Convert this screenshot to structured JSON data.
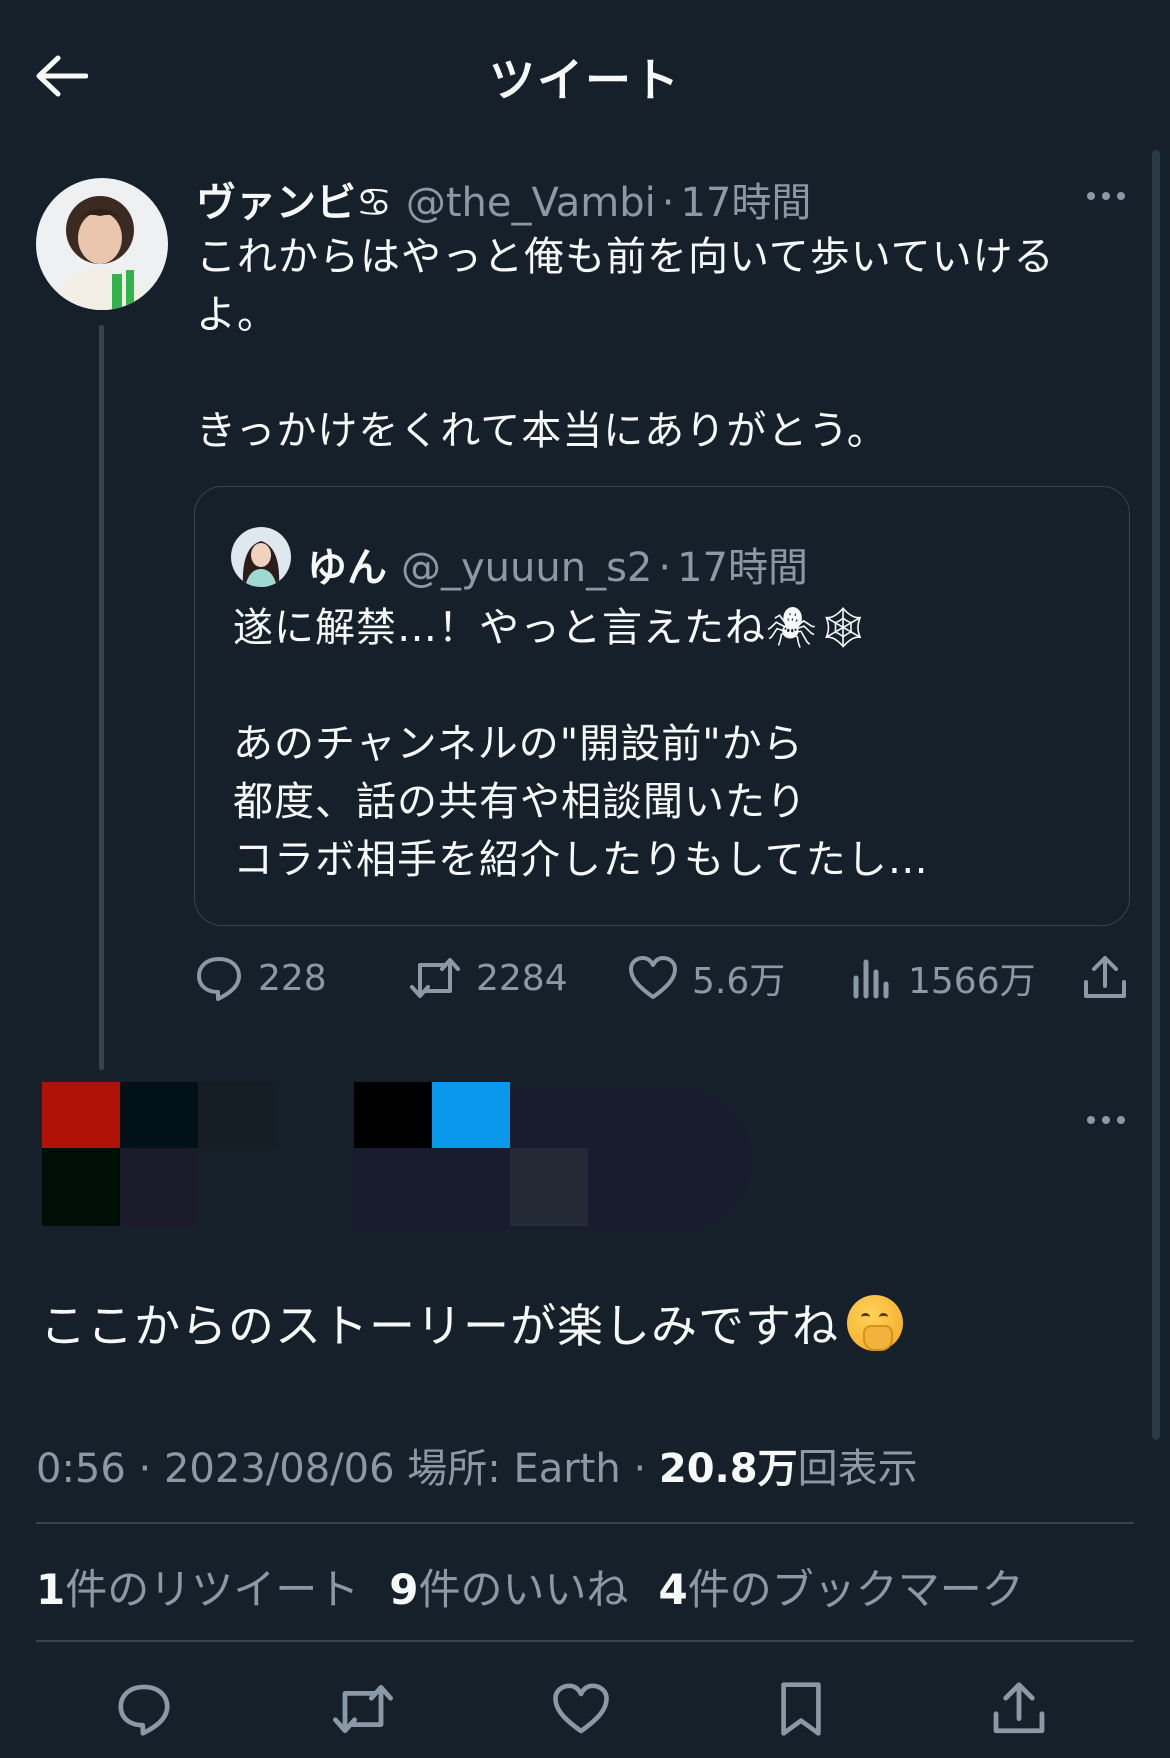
{
  "header": {
    "title": "ツイート"
  },
  "tweet": {
    "name": "ヴァンビ♋",
    "handle": "@the_Vambi",
    "sep": "·",
    "time": "17時間",
    "text": "これからはやっと俺も前を向いて歩いていける\nよ。\n\nきっかけをくれて本当にありがとう。",
    "quote": {
      "name": "ゆん",
      "handle": "@_yuuun_s2",
      "sep": "·",
      "time": "17時間",
      "text": "遂に解禁…！やっと言えたね🕷🕸\n\nあのチャンネルの\"開設前\"から\n都度、話の共有や相談聞いたり\nコラボ相手を紹介したりもしてたし…"
    },
    "actions": {
      "reply_count": "228",
      "retweet_count": "2284",
      "like_count": "5.6万",
      "view_count": "1566万"
    }
  },
  "reply": {
    "text": "ここからのストーリーが楽しみですね",
    "emoji_icon": "hand-over-mouth-emoji"
  },
  "meta": {
    "time": "0:56",
    "sep1": "·",
    "date": "2023/08/06",
    "location": "場所: Earth",
    "sep2": "·",
    "views": "20.8万",
    "views_label": "回表示"
  },
  "counts": {
    "retweets": "1",
    "retweets_label": "件のリツイート",
    "likes": "9",
    "likes_label": "件のいいね",
    "bookmarks": "4",
    "bookmarks_label": "件のブックマーク"
  },
  "colors": {
    "background": "#15202b",
    "text": "#f7f9f9",
    "muted": "#8b98a5",
    "border": "#38444d"
  }
}
